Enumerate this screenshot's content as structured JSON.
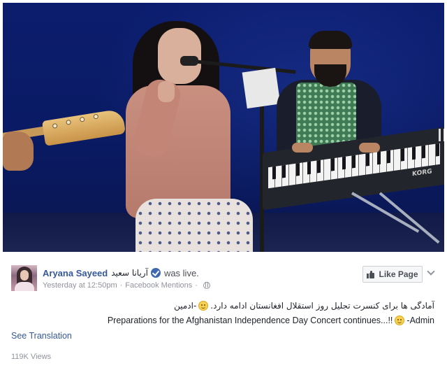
{
  "video": {
    "brand_text": "KORG"
  },
  "post": {
    "page_name": "Aryana Sayeed",
    "page_name_alt": "آریانا سعید",
    "was_live": "was live.",
    "timestamp": "Yesterday at 12:50pm",
    "separator": "·",
    "source": "Facebook Mentions",
    "like_page_label": "Like Page",
    "message_fa_text": "آمادگی ها برای کنسرت تجلیل روز استقلال افغانستان ادامه دارد.",
    "message_fa_suffix": "-ادمین",
    "message_en_text": "Preparations for the Afghanistan Independence Day Concert continues...!!",
    "message_en_suffix": "-Admin",
    "see_translation": "See Translation",
    "views": "119K Views"
  },
  "icons": {
    "verified": "verified-badge-icon",
    "globe": "globe-icon",
    "like": "thumbs-up-icon",
    "menu": "chevron-down-icon",
    "emoji": "smiley-icon"
  },
  "colors": {
    "link_blue": "#365899",
    "verified_blue": "#4267b2",
    "meta_gray": "#90949c",
    "text_dark": "#1d2129"
  }
}
